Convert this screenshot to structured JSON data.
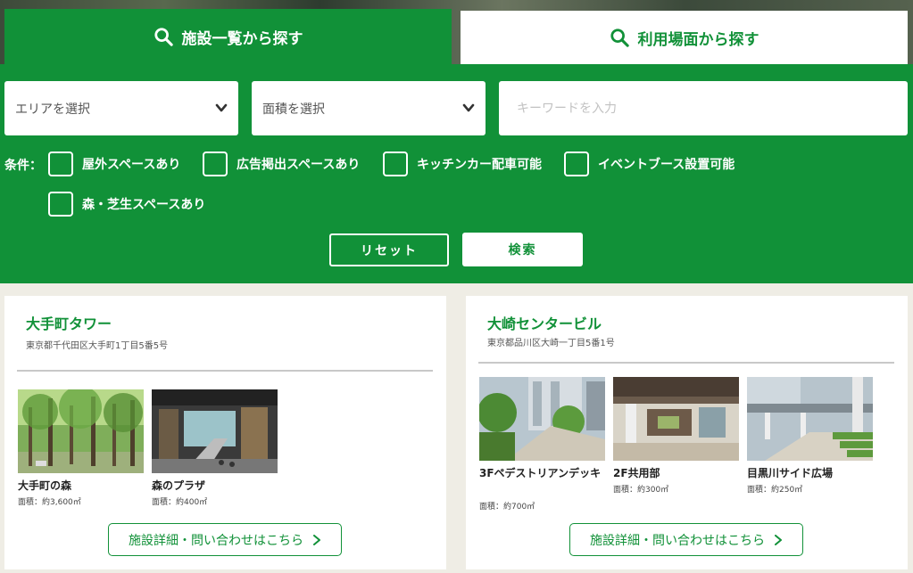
{
  "tabs": {
    "facility_list": "施設一覧から探す",
    "usage_scene": "利用場面から探す"
  },
  "filters": {
    "area_select": "エリアを選択",
    "size_select": "面積を選択",
    "keyword_placeholder": "キーワードを入力",
    "conditions_label": "条件：",
    "conditions": [
      "屋外スペースあり",
      "広告掲出スペースあり",
      "キッチンカー配車可能",
      "イベントブース設置可能",
      "森・芝生スペースあり"
    ],
    "reset_label": "リセット",
    "search_label": "検索"
  },
  "facilities": [
    {
      "name": "大手町タワー",
      "address": "東京都千代田区大手町1丁目5番5号",
      "places": [
        {
          "name": "大手町の森",
          "area": "面積：約3,600㎡"
        },
        {
          "name": "森のプラザ",
          "area": "面積：約400㎡"
        }
      ],
      "detail_label": "施設詳細・問い合わせはこちら"
    },
    {
      "name": "大崎センタービル",
      "address": "東京都品川区大崎一丁目5番1号",
      "places": [
        {
          "name": "3Fペデストリアンデッキ",
          "area": "面積：約700㎡"
        },
        {
          "name": "2F共用部",
          "area": "面積：約300㎡"
        },
        {
          "name": "目黒川サイド広場",
          "area": "面積：約250㎡"
        }
      ],
      "detail_label": "施設詳細・問い合わせはこちら"
    }
  ],
  "colors": {
    "brand_green": "#119138",
    "background": "#efede5"
  },
  "icons": {
    "tab": "search-icon",
    "select": "chevron-down-icon",
    "detail": "chevron-right-icon"
  }
}
